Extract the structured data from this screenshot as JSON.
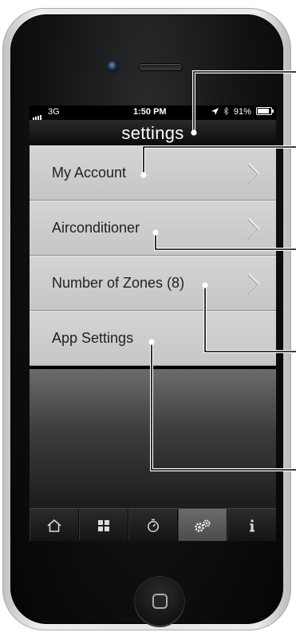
{
  "status_bar": {
    "carrier": "3G",
    "time": "1:50 PM",
    "battery": "91%"
  },
  "header": {
    "title": "settings"
  },
  "menu": {
    "items": [
      {
        "label": "My Account",
        "has_chevron": true
      },
      {
        "label": "Airconditioner",
        "has_chevron": true
      },
      {
        "label": "Number of Zones (8)",
        "has_chevron": true
      },
      {
        "label": "App Settings",
        "has_chevron": false
      }
    ]
  },
  "tab_bar": {
    "tabs": [
      {
        "icon": "home-icon",
        "active": false
      },
      {
        "icon": "grid-icon",
        "active": false
      },
      {
        "icon": "timer-icon",
        "active": false
      },
      {
        "icon": "gears-icon",
        "active": true
      },
      {
        "icon": "info-icon",
        "active": false
      }
    ]
  }
}
